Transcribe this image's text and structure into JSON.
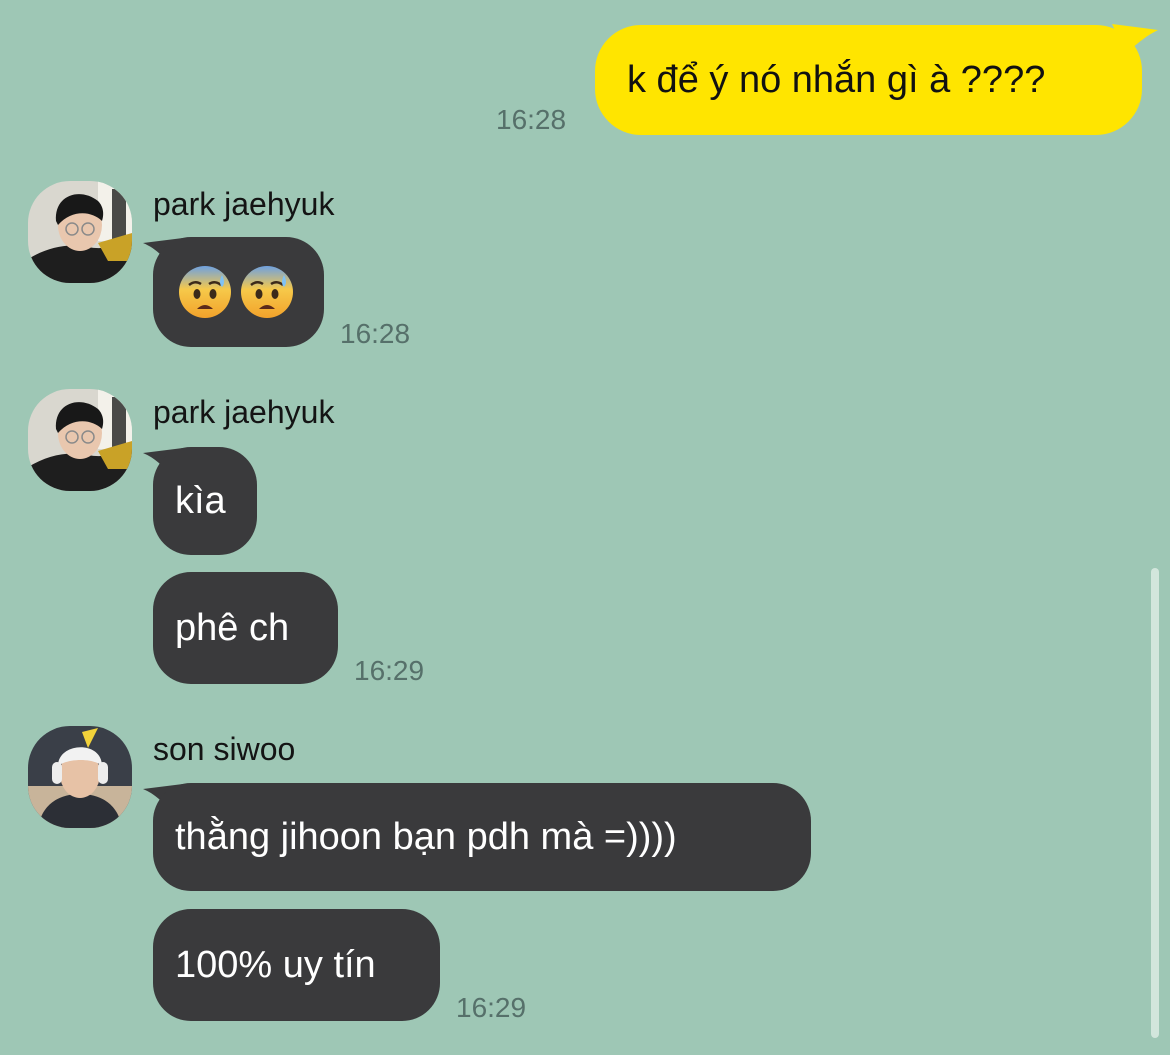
{
  "colors": {
    "background": "#9ec7b5",
    "outgoing_bubble": "#ffe500",
    "incoming_bubble": "#3a3a3c",
    "timestamp": "#56706a"
  },
  "messages": {
    "m1": {
      "text": "k để ý nó nhắn gì à ????",
      "time": "16:28"
    },
    "m2": {
      "sender": "park jaehyuk",
      "content": "emoji-anxious-face-with-sweat x2",
      "time": "16:28"
    },
    "m3": {
      "sender": "park jaehyuk",
      "text1": "kìa",
      "text2": "phê ch",
      "time": "16:29"
    },
    "m4": {
      "sender": "son siwoo",
      "text1": "thằng jihoon bạn pdh mà =))))",
      "text2": "100% uy tín",
      "time": "16:29"
    }
  },
  "avatars": {
    "park_jaehyuk": "avatar-photo-park-jaehyuk",
    "son_siwoo": "avatar-photo-son-siwoo"
  }
}
